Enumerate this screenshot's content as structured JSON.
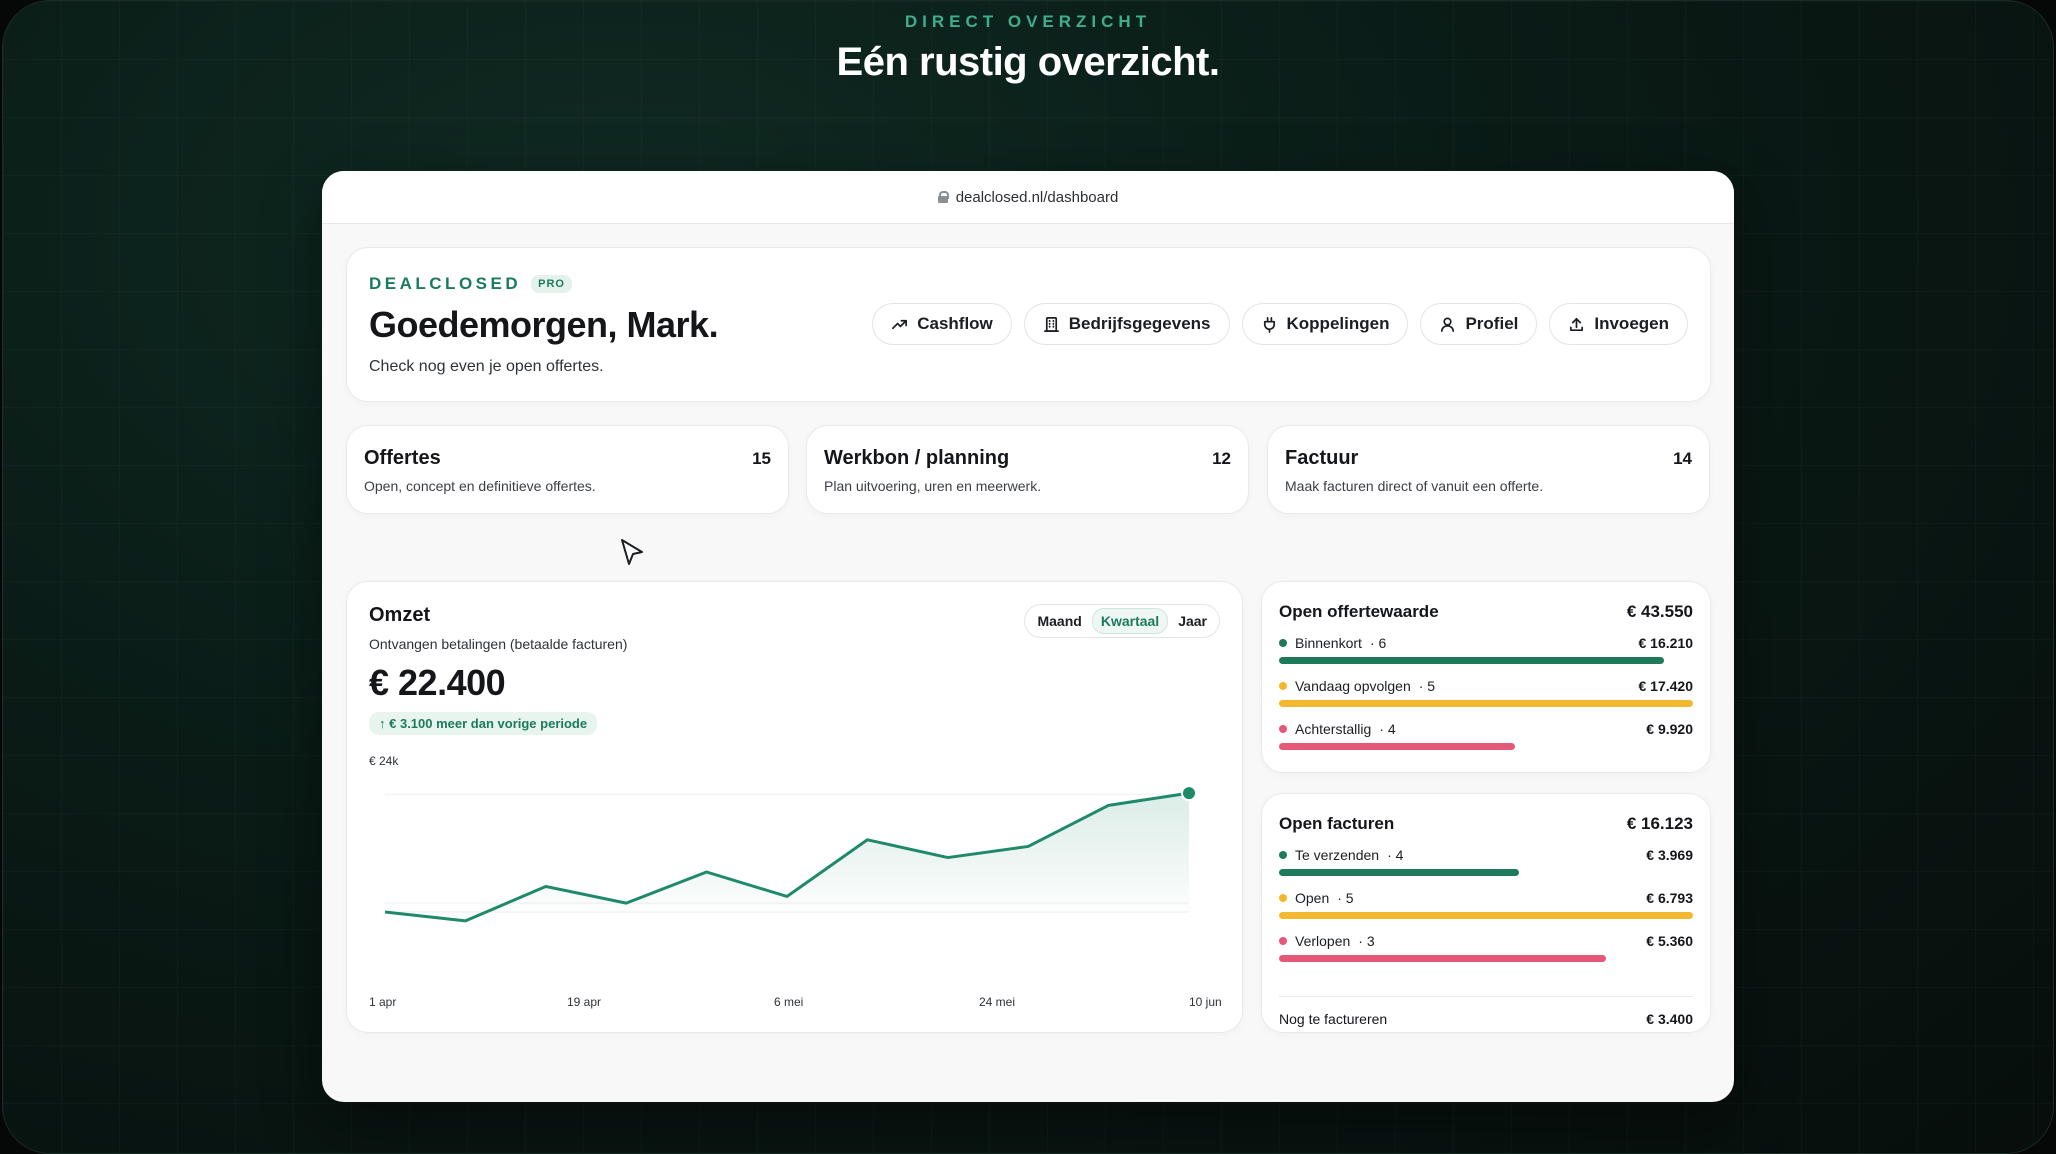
{
  "hero": {
    "eyebrow": "DIRECT OVERZICHT",
    "headline": "Eén rustig overzicht."
  },
  "browser": {
    "url": "dealclosed.nl/dashboard"
  },
  "header": {
    "brand": "DEALCLOSED",
    "badge": "PRO",
    "greeting": "Goedemorgen, Mark.",
    "subtitle": "Check nog even je open offertes.",
    "actions": [
      "Cashflow",
      "Bedrijfsgegevens",
      "Koppelingen",
      "Profiel",
      "Invoegen"
    ]
  },
  "stats": [
    {
      "title": "Offertes",
      "count": "15",
      "desc": "Open, concept en definitieve offertes."
    },
    {
      "title": "Werkbon / planning",
      "count": "12",
      "desc": "Plan uitvoering, uren en meerwerk."
    },
    {
      "title": "Factuur",
      "count": "14",
      "desc": "Maak facturen direct of vanuit een offerte."
    }
  ],
  "revenue": {
    "title": "Omzet",
    "subtitle": "Ontvangen betalingen (betaalde facturen)",
    "total": "€ 22.400",
    "delta": "€ 3.100 meer dan vorige periode",
    "periods": [
      "Maand",
      "Kwartaal",
      "Jaar"
    ],
    "active_period": "Kwartaal",
    "y_label": "€ 24k"
  },
  "chart_data": {
    "type": "area",
    "x_tick_labels": [
      "1 apr",
      "19 apr",
      "6 mei",
      "24 mei",
      "10 jun"
    ],
    "values": [
      13400,
      12600,
      15700,
      14200,
      17000,
      14800,
      19900,
      18300,
      19300,
      23000,
      24100
    ],
    "ylim": [
      8000,
      26000
    ],
    "color": "#1f8a6a"
  },
  "open_quotes": {
    "title": "Open offertewaarde",
    "total": "€ 43.550",
    "rows": [
      {
        "label": "Binnenkort",
        "count": "· 6",
        "amount": "€ 16.210",
        "fill": 0.93,
        "color": "#1f7a5c"
      },
      {
        "label": "Vandaag opvolgen",
        "count": "· 5",
        "amount": "€ 17.420",
        "fill": 1.0,
        "color": "#f2b92e"
      },
      {
        "label": "Achterstallig",
        "count": "· 4",
        "amount": "€ 9.920",
        "fill": 0.57,
        "color": "#e5587a"
      }
    ]
  },
  "open_invoices": {
    "title": "Open facturen",
    "total": "€ 16.123",
    "rows": [
      {
        "label": "Te verzenden",
        "count": "· 4",
        "amount": "€ 3.969",
        "fill": 0.58,
        "color": "#1f7a5c"
      },
      {
        "label": "Open",
        "count": "· 5",
        "amount": "€ 6.793",
        "fill": 1.0,
        "color": "#f2b92e"
      },
      {
        "label": "Verlopen",
        "count": "· 3",
        "amount": "€ 5.360",
        "fill": 0.79,
        "color": "#e5587a"
      }
    ],
    "footer_label": "Nog te factureren",
    "footer_amount": "€ 3.400"
  }
}
